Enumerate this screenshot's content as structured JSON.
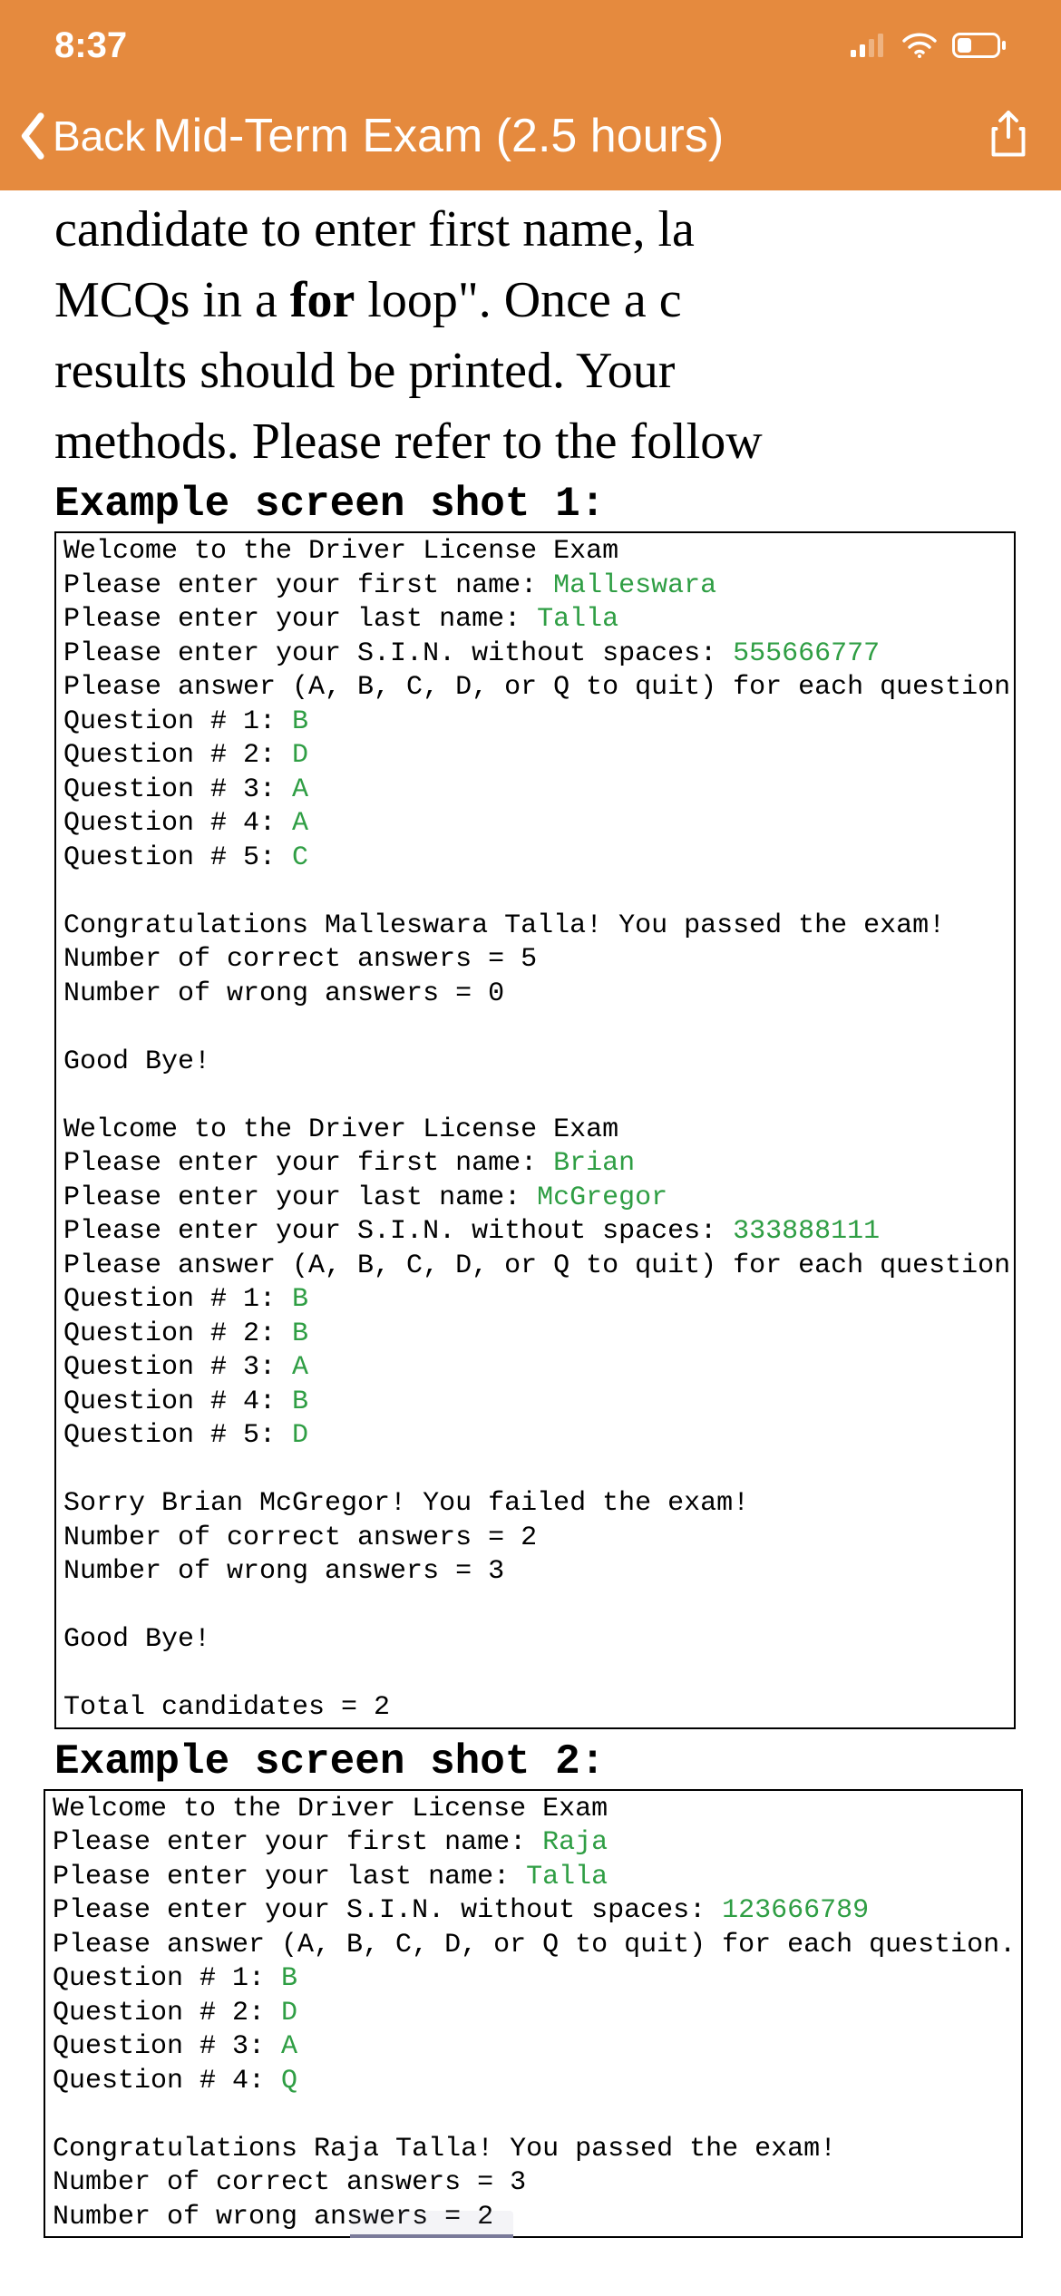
{
  "status": {
    "time": "8:37"
  },
  "nav": {
    "back": "Back",
    "title": "Mid-Term Exam (2.5 hours)"
  },
  "body": {
    "l1a": "candidate to enter first name, la",
    "l2a": "MCQs in a ",
    "l2b": "for",
    "l2c": " loop\". Once a c",
    "l3": "results should be printed. Your",
    "l4": "methods. Please refer to the follow"
  },
  "heading1": "Example screen shot 1:",
  "heading2": "Example screen shot 2:",
  "c1": {
    "welcome": "Welcome to the Driver License Exam",
    "pf": "Please enter your first name: ",
    "pf_v": "Malleswara",
    "pl": "Please enter your last name: ",
    "pl_v": "Talla",
    "ps": "Please enter your S.I.N. without spaces: ",
    "ps_v": "555666777",
    "pa": "Please answer (A, B, C, D, or Q to quit) for each question.",
    "q1": "Question # 1: ",
    "q1v": "B",
    "q2": "Question # 2: ",
    "q2v": "D",
    "q3": "Question # 3: ",
    "q3v": "A",
    "q4": "Question # 4: ",
    "q4v": "A",
    "q5": "Question # 5: ",
    "q5v": "C",
    "res1": "Congratulations Malleswara Talla! You passed the exam!",
    "res2": "Number of correct answers = 5",
    "res3": "Number of wrong answers = 0",
    "bye": "Good Bye!",
    "pf2_v": "Brian",
    "pl2_v": "McGregor",
    "ps2_v": "333888111",
    "r2q1": "Question # 1: ",
    "r2q1v": "B",
    "r2q2": "Question # 2: ",
    "r2q2v": "B",
    "r2q3": "Question # 3: ",
    "r2q3v": "A",
    "r2q4": "Question # 4: ",
    "r2q4v": "B",
    "r2q5": "Question # 5: ",
    "r2q5v": "D",
    "r2res1": "Sorry Brian McGregor! You failed the exam!",
    "r2res2": "Number of correct answers = 2",
    "r2res3": "Number of wrong answers = 3",
    "total": "Total candidates = 2"
  },
  "c2": {
    "welcome": "Welcome to the Driver License Exam",
    "pf": "Please enter your first name: ",
    "pf_v": "Raja",
    "pl": "Please enter your last name: ",
    "pl_v": "Talla",
    "ps": "Please enter your S.I.N. without spaces: ",
    "ps_v": "123666789",
    "pa": "Please answer (A, B, C, D, or Q to quit) for each question.",
    "q1": "Question # 1: ",
    "q1v": "B",
    "q2": "Question # 2: ",
    "q2v": "D",
    "q3": "Question # 3: ",
    "q3v": "A",
    "q4": "Question # 4: ",
    "q4v": "Q",
    "res1": "Congratulations Raja Talla! You passed the exam!",
    "res2": "Number of correct answers = 3",
    "res3": "Number of wrong answers = 2"
  }
}
